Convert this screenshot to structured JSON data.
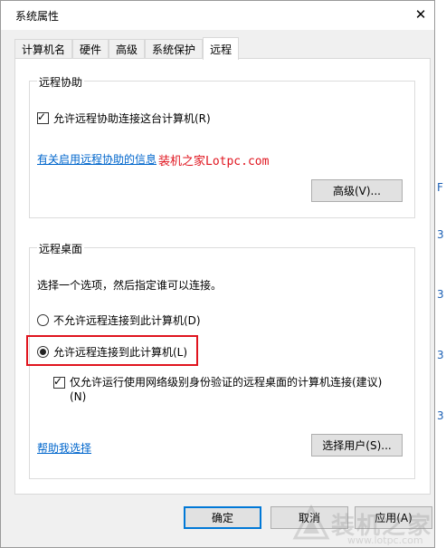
{
  "window": {
    "title": "系统属性",
    "close_glyph": "✕"
  },
  "tabs": [
    {
      "label": "计算机名",
      "active": false
    },
    {
      "label": "硬件",
      "active": false
    },
    {
      "label": "高级",
      "active": false
    },
    {
      "label": "系统保护",
      "active": false
    },
    {
      "label": "远程",
      "active": true
    }
  ],
  "remote_assistance": {
    "group_title": "远程协助",
    "allow_checkbox_label": "允许远程协助连接这台计算机(R)",
    "allow_checked": true,
    "help_link": "有关启用远程协助的信息",
    "advanced_button": "高级(V)..."
  },
  "watermark_text": "装机之家Lotpc.com",
  "remote_desktop": {
    "group_title": "远程桌面",
    "instruction": "选择一个选项，然后指定谁可以连接。",
    "option_deny": "不允许远程连接到此计算机(D)",
    "option_allow": "允许远程连接到此计算机(L)",
    "selected": "allow",
    "nla_checkbox_label_line1": "仅允许运行使用网络级别身份验证的远程桌面的计算机连接(建议)",
    "nla_checkbox_label_line2": "(N)",
    "nla_checked": true,
    "help_link": "帮助我选择",
    "select_users_button": "选择用户(S)..."
  },
  "footer": {
    "ok_button": "确定",
    "cancel_button": "取消",
    "apply_button": "应用(A)"
  },
  "logo": {
    "text": "装机之家",
    "sub": "www.lotpc.com"
  },
  "colors": {
    "accent_blue": "#0078d7",
    "link_blue": "#0066cc",
    "highlight_red": "#e0141e"
  },
  "icons": {
    "close": "close-icon",
    "check": "checkmark-icon"
  }
}
